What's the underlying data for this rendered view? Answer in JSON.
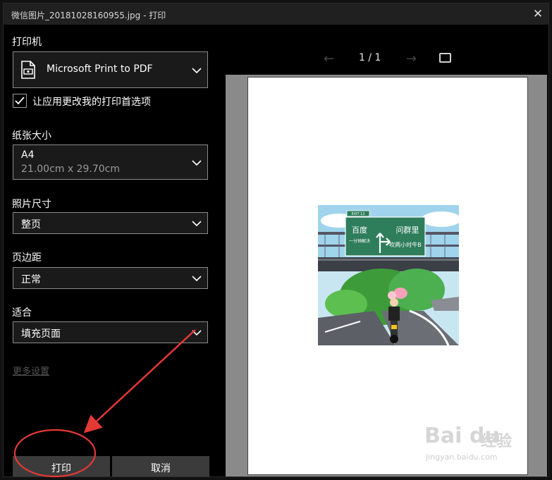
{
  "window": {
    "title": "微信图片_20181028160955.jpg - 打印",
    "close": "✕"
  },
  "printer": {
    "label": "打印机",
    "selected": "Microsoft Print to PDF",
    "icon": "printer-icon"
  },
  "preferences": {
    "checked": true,
    "label": "让应用更改我的打印首选项"
  },
  "paper_size": {
    "label": "纸张大小",
    "value": "A4",
    "detail": "21.00cm x 29.70cm"
  },
  "photo_size": {
    "label": "照片尺寸",
    "value": "整页"
  },
  "margins": {
    "label": "页边距",
    "value": "正常"
  },
  "fit": {
    "label": "适合",
    "value": "填充页面"
  },
  "more_settings": "更多设置",
  "buttons": {
    "print": "打印",
    "cancel": "取消"
  },
  "preview": {
    "page_indicator": "1 / 1",
    "prev": "←",
    "next": "→"
  },
  "photo": {
    "sign_left": "百度",
    "sign_left_sub": "一分钟解决",
    "sign_right": "问群里",
    "sign_right_sub": "吹两小时牛B",
    "exit_tag": "EXIT 12"
  },
  "watermark": {
    "logo": "Bai du",
    "brand": "经验",
    "url": "jingyan.baidu.com"
  },
  "colors": {
    "annotation": "#e53935",
    "sign": "#2e7d5b",
    "preview_bg": "#8a8a8a"
  }
}
